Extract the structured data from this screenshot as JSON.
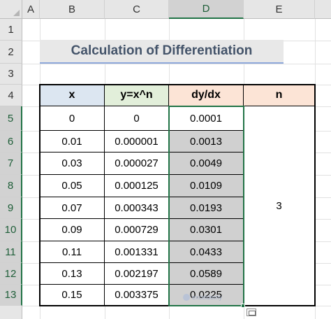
{
  "columns": [
    "A",
    "B",
    "C",
    "D",
    "E"
  ],
  "rows": [
    "1",
    "2",
    "3",
    "4",
    "5",
    "6",
    "7",
    "8",
    "9",
    "10",
    "11",
    "12",
    "13"
  ],
  "title": "Calculation of Differentiation",
  "table": {
    "headers": [
      "x",
      "y=x^n",
      "dy/dx",
      "n"
    ],
    "rows": [
      {
        "x": "0",
        "y": "0",
        "dydx": "0.0001"
      },
      {
        "x": "0.01",
        "y": "0.000001",
        "dydx": "0.0013"
      },
      {
        "x": "0.03",
        "y": "0.000027",
        "dydx": "0.0049"
      },
      {
        "x": "0.05",
        "y": "0.000125",
        "dydx": "0.0109"
      },
      {
        "x": "0.07",
        "y": "0.000343",
        "dydx": "0.0193"
      },
      {
        "x": "0.09",
        "y": "0.000729",
        "dydx": "0.0301"
      },
      {
        "x": "0.11",
        "y": "0.001331",
        "dydx": "0.0433"
      },
      {
        "x": "0.13",
        "y": "0.002197",
        "dydx": "0.0589"
      },
      {
        "x": "0.15",
        "y": "0.003375",
        "dydx": "0.0225"
      }
    ],
    "n_value": "3"
  },
  "selection": {
    "column": "D",
    "rows": "5:13"
  },
  "watermark": "exceldemy",
  "colors": {
    "accent": "#217346",
    "title_text": "#44546a",
    "header_x": "#dce6f1",
    "header_y": "#e2efda",
    "header_dydx": "#fce4d6",
    "selected_fill": "#d0d0d0"
  },
  "icons": {
    "quick_analysis": "quick-analysis-icon"
  }
}
